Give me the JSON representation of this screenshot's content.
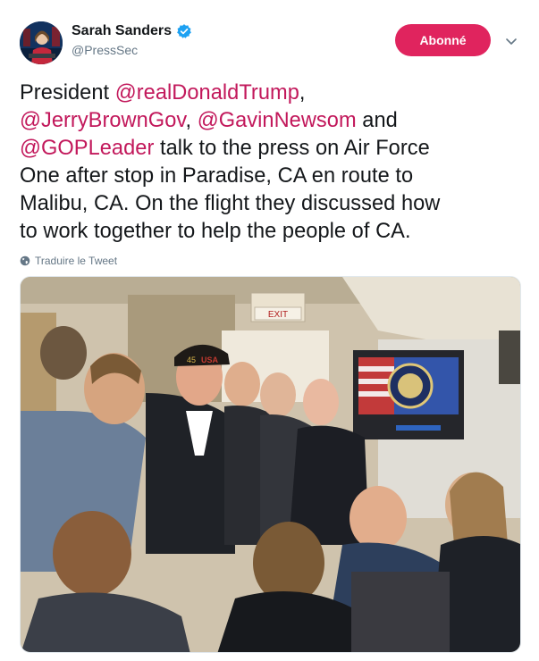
{
  "author": {
    "display_name": "Sarah Sanders",
    "handle": "@PressSec",
    "verified_icon": "verified-badge-icon",
    "avatar_icon": "profile-photo"
  },
  "actions": {
    "follow_label": "Abonné",
    "menu_icon": "chevron-down-icon"
  },
  "tweet": {
    "line1_pre": "President ",
    "mention_trump": "@realDonaldTrump",
    "line1_post": ",",
    "mention_brown": "@JerryBrownGov",
    "line2_sep": ", ",
    "mention_newsom": "@GavinNewsom",
    "line2_post": " and",
    "mention_gop": "@GOPLeader",
    "line3_post": " talk to the press on Air Force",
    "line4": "One after stop in Paradise, CA en route to",
    "line5": "Malibu, CA. On the flight they discussed how",
    "line6": "to work together to help the people of CA."
  },
  "translate": {
    "label": "Traduire le Tweet",
    "icon": "globe-icon"
  },
  "photo": {
    "exit_sign": "EXIT",
    "cap_number": "45",
    "cap_text": "USA"
  },
  "colors": {
    "accent": "#e0245e",
    "mention": "#c2185b",
    "verified": "#1da1f2",
    "secondary_text": "#657786"
  }
}
